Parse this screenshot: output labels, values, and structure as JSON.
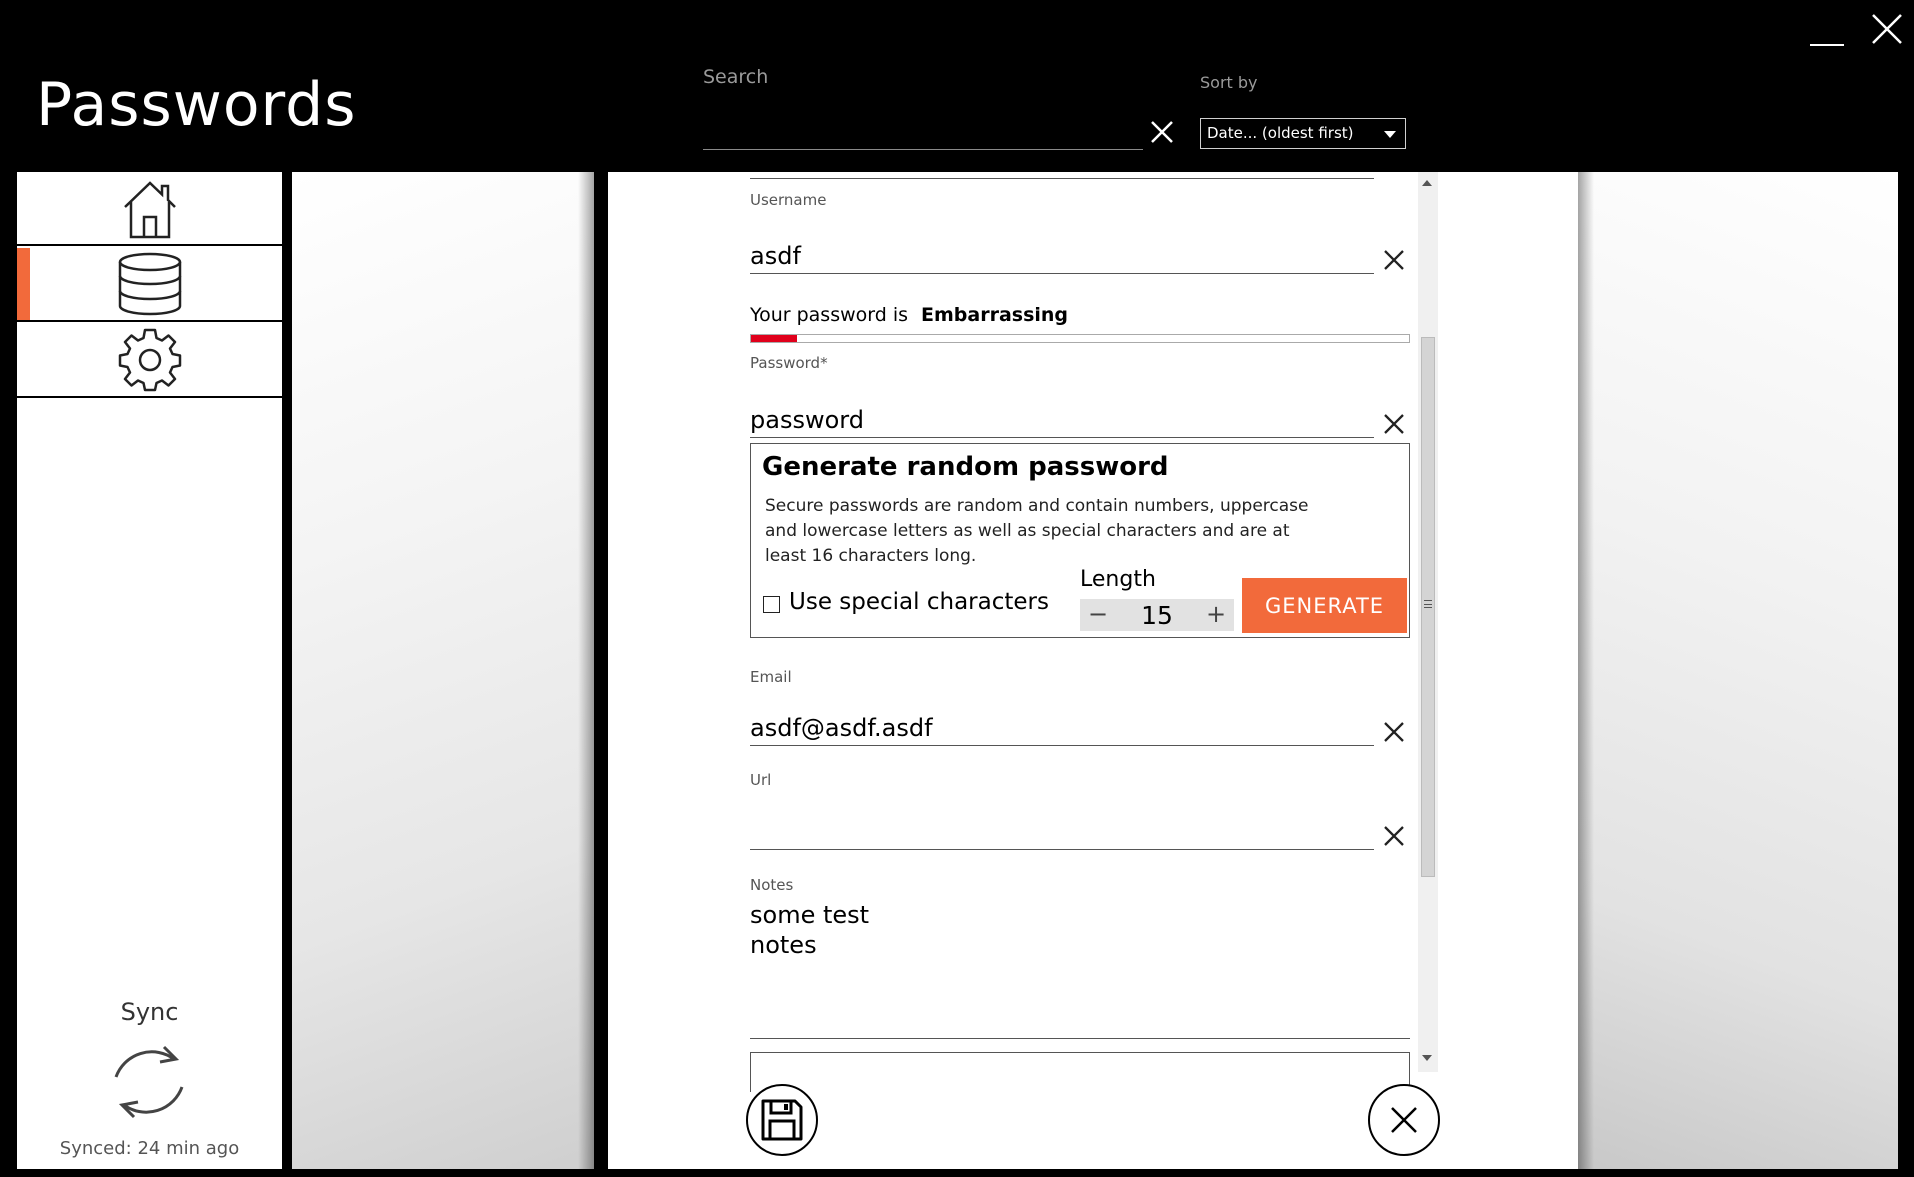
{
  "app": {
    "title": "Passwords"
  },
  "header": {
    "search_label": "Search",
    "search_value": "",
    "sort_label": "Sort by",
    "sort_value": "Date... (oldest first)"
  },
  "sidebar": {
    "items": [
      {
        "name": "home",
        "icon": "home-icon",
        "active": false
      },
      {
        "name": "database",
        "icon": "database-icon",
        "active": true
      },
      {
        "name": "settings",
        "icon": "gear-icon",
        "active": false
      }
    ],
    "sync_label": "Sync",
    "sync_status": "Synced: 24 min ago"
  },
  "form": {
    "username": {
      "label": "Username",
      "value": "asdf"
    },
    "strength": {
      "prefix": "Your password is",
      "value": "Embarrassing",
      "level": 0.07,
      "color": "#e0001b"
    },
    "password": {
      "label": "Password*",
      "value": "password"
    },
    "generator": {
      "title": "Generate random password",
      "description": "Secure passwords are random and contain numbers, uppercase and lowercase letters as well as special characters and are at least 16 characters long.",
      "special_label": "Use special characters",
      "special_checked": false,
      "length_label": "Length",
      "length_value": "15",
      "minus": "−",
      "plus": "+",
      "generate_label": "GENERATE"
    },
    "email": {
      "label": "Email",
      "value": "asdf@asdf.asdf"
    },
    "url": {
      "label": "Url",
      "value": ""
    },
    "notes": {
      "label": "Notes",
      "value": "some test\nnotes"
    }
  },
  "colors": {
    "accent": "#f26a3b",
    "background": "#000000",
    "panel": "#ffffff"
  }
}
